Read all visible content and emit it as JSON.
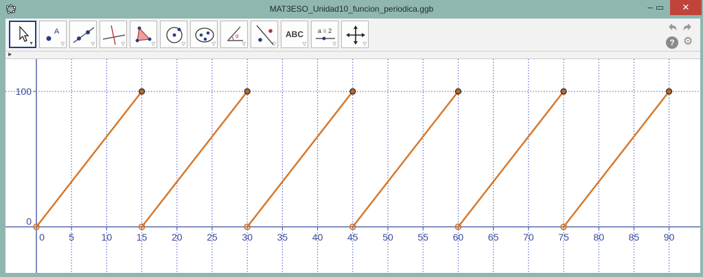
{
  "window": {
    "title": "MAT3ESO_Unidad10_funcion_periodica.ggb",
    "minimize": "‒",
    "maximize": "▭",
    "close": "✕"
  },
  "toolbar": {
    "tools": [
      {
        "icon": "move-arrow-icon",
        "selected": true
      },
      {
        "icon": "point-icon",
        "selected": false
      },
      {
        "icon": "line-icon",
        "selected": false
      },
      {
        "icon": "perpendicular-line-icon",
        "selected": false
      },
      {
        "icon": "polygon-icon",
        "selected": false
      },
      {
        "icon": "circle-icon",
        "selected": false
      },
      {
        "icon": "ellipse-icon",
        "selected": false
      },
      {
        "icon": "angle-icon",
        "selected": false
      },
      {
        "icon": "reflect-icon",
        "selected": false
      },
      {
        "icon": "text-icon",
        "selected": false,
        "label": "ABC"
      },
      {
        "icon": "slider-icon",
        "selected": false,
        "label": "a = 2"
      },
      {
        "icon": "move-view-icon",
        "selected": false
      }
    ],
    "help": "?"
  },
  "graph": {
    "x_ticks": [
      "0",
      "5",
      "10",
      "15",
      "20",
      "25",
      "30",
      "35",
      "40",
      "45",
      "50",
      "55",
      "60",
      "65",
      "70",
      "75",
      "80",
      "85",
      "90"
    ],
    "y_ticks": [
      "0",
      "100"
    ],
    "segment_color": "#d6782b",
    "grid_color": "#3d4ec4",
    "axis_color": "#3a4a9a"
  },
  "chart_data": {
    "type": "line",
    "xlim": [
      0,
      95
    ],
    "ylim": [
      0,
      100
    ],
    "grid": true,
    "segments": [
      {
        "x": [
          0,
          15
        ],
        "y": [
          0,
          100
        ]
      },
      {
        "x": [
          15,
          30
        ],
        "y": [
          0,
          100
        ]
      },
      {
        "x": [
          30,
          45
        ],
        "y": [
          0,
          100
        ]
      },
      {
        "x": [
          45,
          60
        ],
        "y": [
          0,
          100
        ]
      },
      {
        "x": [
          60,
          75
        ],
        "y": [
          0,
          100
        ]
      },
      {
        "x": [
          75,
          90
        ],
        "y": [
          0,
          100
        ]
      }
    ]
  }
}
